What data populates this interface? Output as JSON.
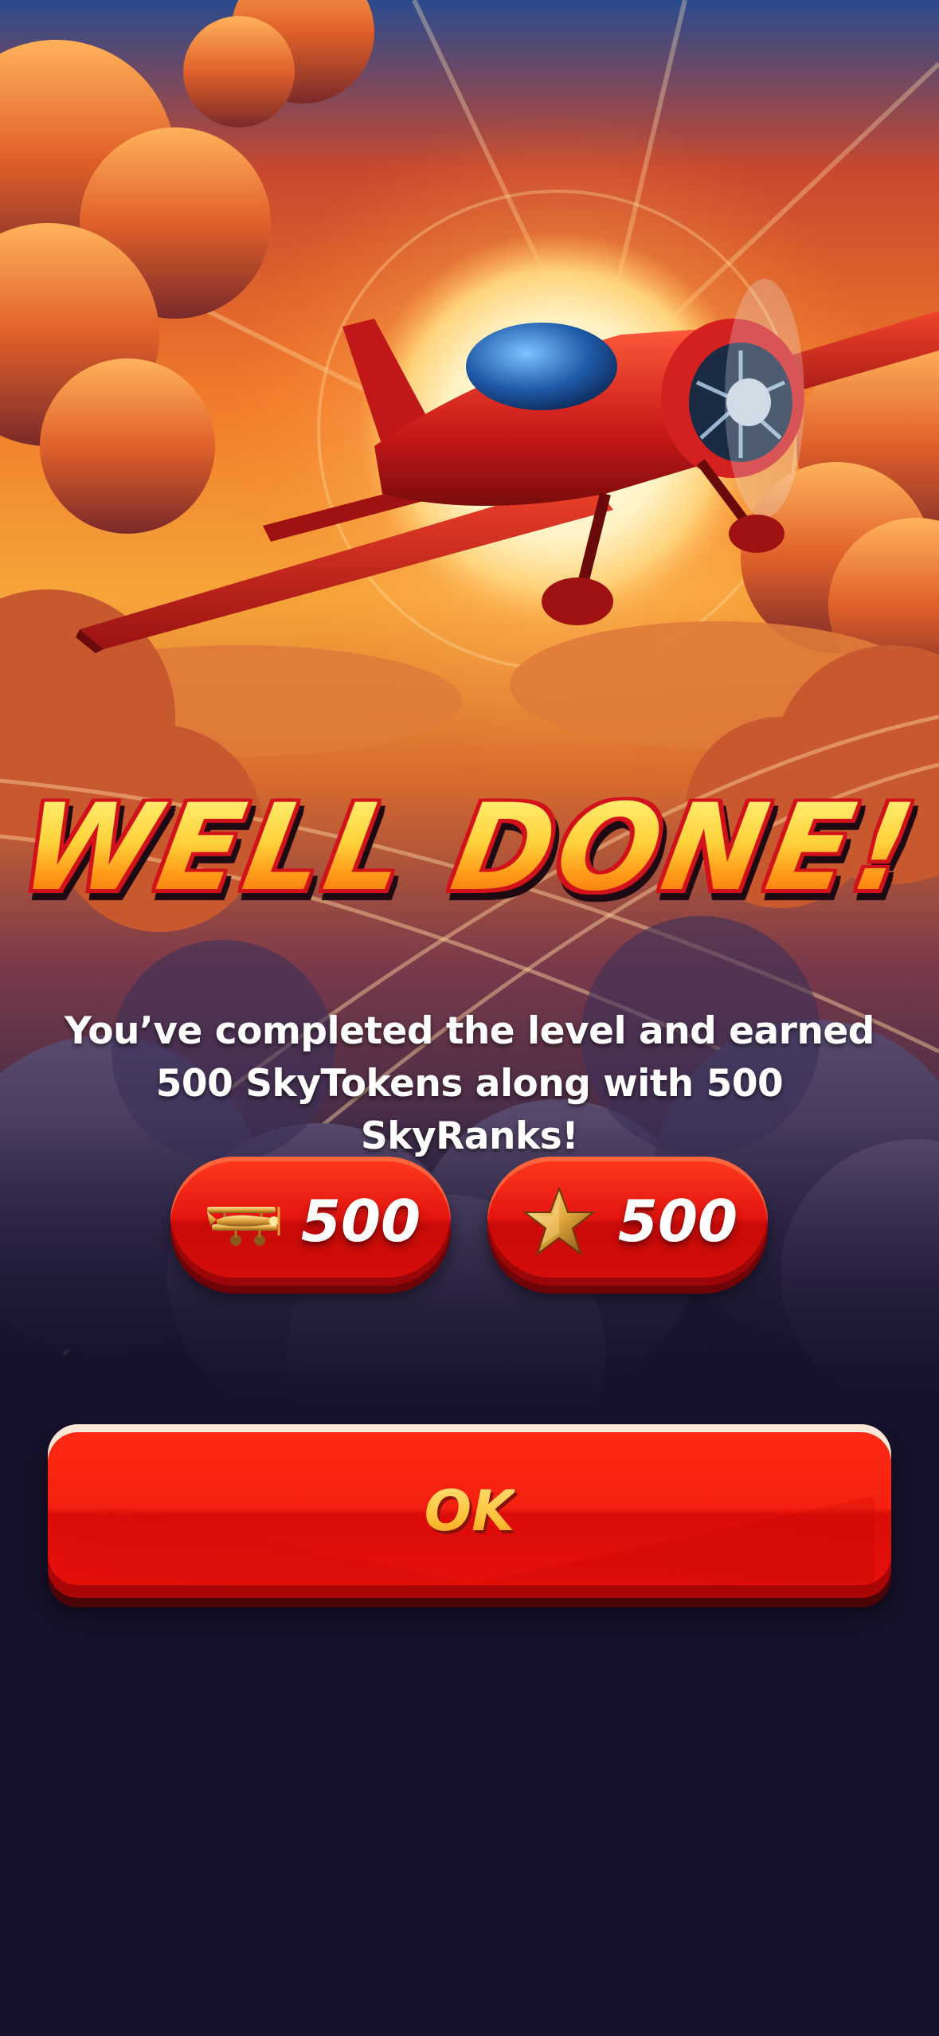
{
  "screen": {
    "title": "WELL DONE!",
    "message": "You’ve completed the level and earned 500 SkyTokens along with 500 SkyRanks!"
  },
  "rewards": [
    {
      "icon": "biplane-icon",
      "value": "500"
    },
    {
      "icon": "star-icon",
      "value": "500"
    }
  ],
  "actions": {
    "ok_label": "OK"
  },
  "colors": {
    "background": "#15122b",
    "button_red": "#e8110c",
    "title_gold": "#ffcf3a",
    "title_outline": "#d2121a"
  }
}
